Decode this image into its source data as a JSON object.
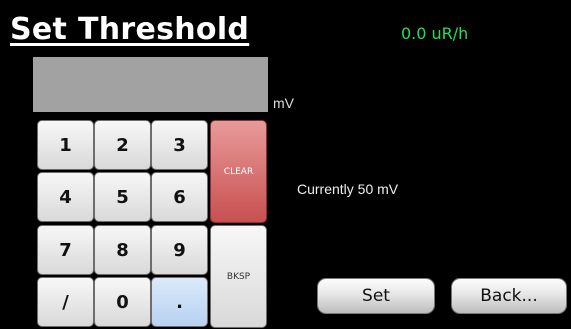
{
  "header": {
    "title": "Set Threshold",
    "reading": "0.0 uR/h"
  },
  "entry": {
    "value": "",
    "unit": "mV"
  },
  "keypad": {
    "k1": "1",
    "k2": "2",
    "k3": "3",
    "k4": "4",
    "k5": "5",
    "k6": "6",
    "k7": "7",
    "k8": "8",
    "k9": "9",
    "kslash": "/",
    "k0": "0",
    "kdot": ".",
    "clear": "CLEAR",
    "bksp": "BKSP"
  },
  "status": {
    "current": "Currently 50 mV"
  },
  "buttons": {
    "set": "Set",
    "back": "Back..."
  },
  "colors": {
    "reading": "#22e052",
    "clear_key": "#c85050",
    "dot_key": "#b8d2f1"
  }
}
